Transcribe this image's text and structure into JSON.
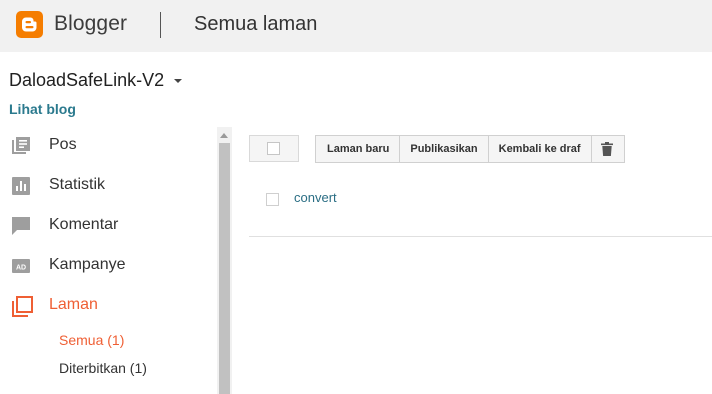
{
  "header": {
    "brand": "Blogger",
    "page_title": "Semua laman",
    "logo_color": "#f57d00"
  },
  "blog": {
    "name": "DaloadSafeLink-V2",
    "view_blog": "Lihat blog"
  },
  "sidebar": {
    "items": [
      {
        "label": "Pos",
        "icon": "posts-icon"
      },
      {
        "label": "Statistik",
        "icon": "stats-icon"
      },
      {
        "label": "Komentar",
        "icon": "comment-icon"
      },
      {
        "label": "Kampanye",
        "icon": "ad-icon"
      },
      {
        "label": "Laman",
        "icon": "pages-icon",
        "active": true
      }
    ],
    "subitems": [
      {
        "label": "Semua (1)",
        "active": true
      },
      {
        "label": "Diterbitkan (1)"
      }
    ],
    "accent_color": "#ef5f34"
  },
  "toolbar": {
    "new_page": "Laman baru",
    "publish": "Publikasikan",
    "revert_draft": "Kembali ke draf",
    "delete_icon": "trash-icon"
  },
  "pages": [
    {
      "title": "convert"
    }
  ]
}
